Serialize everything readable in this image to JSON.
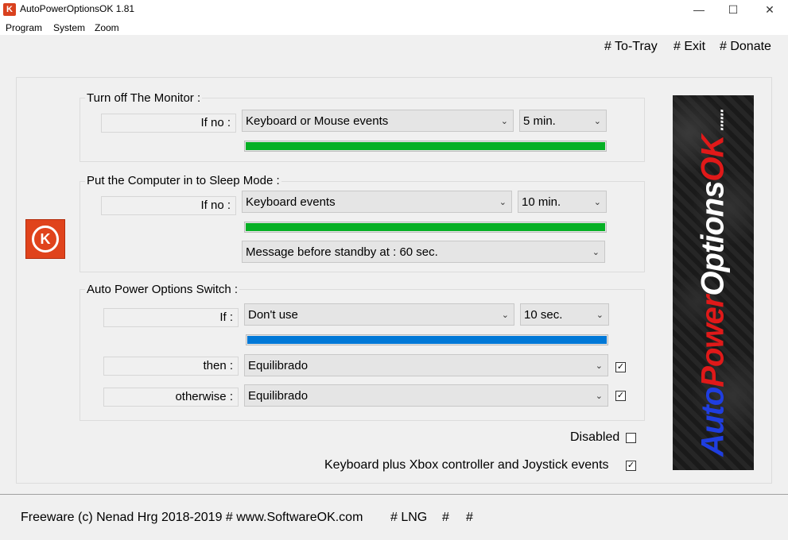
{
  "window": {
    "title": "AutoPowerOptionsOK 1.81",
    "app_icon_glyph": "K",
    "minimize_glyph": "—",
    "maximize_glyph": "☐",
    "close_glyph": "✕"
  },
  "menu": [
    "Program",
    "System",
    "Zoom"
  ],
  "top_links": {
    "tray": "# To-Tray",
    "exit": "# Exit",
    "donate": "# Donate"
  },
  "monitor": {
    "title": "Turn off The Monitor :",
    "if_label": "If no :",
    "event_value": "Keyboard or Mouse events",
    "time_value": "5 min.",
    "progress": 1.0,
    "progress_color": "#06b025"
  },
  "sleep": {
    "title": "Put the Computer in to Sleep Mode :",
    "if_label": "If no :",
    "event_value": "Keyboard events",
    "time_value": "10 min.",
    "progress": 1.0,
    "progress_color": "#06b025",
    "message_value": "Message before standby at : 60 sec."
  },
  "switch": {
    "title": "Auto Power Options Switch :",
    "if_label": "If :",
    "if_value": "Don't use",
    "time_value": "10 sec.",
    "progress": 1.0,
    "progress_color": "#0078d7",
    "then_label": "then :",
    "then_value": "Equilibrado",
    "then_checked": true,
    "otherwise_label": "otherwise :",
    "otherwise_value": "Equilibrado",
    "otherwise_checked": true
  },
  "options": {
    "disabled_label": "Disabled",
    "disabled_checked": false,
    "xbox_label": "Keyboard plus Xbox controller and Joystick events",
    "xbox_checked": true
  },
  "logo": {
    "glyph": "K",
    "color": "#e0431c"
  },
  "banner": {
    "part_auto": "Auto",
    "part_power": "Power",
    "part_options": "Options",
    "part_ok": "OK",
    "dots": "......"
  },
  "footer": {
    "copyright": "Freeware (c) Nenad Hrg 2018-2019 # www.SoftwareOK.com",
    "lng": "# LNG",
    "hash1": "#",
    "hash2": "#"
  }
}
